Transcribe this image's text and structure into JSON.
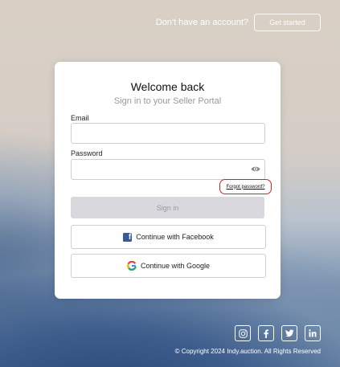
{
  "header": {
    "prompt": "Don't have an account?",
    "get_started_label": "Get started"
  },
  "card": {
    "title": "Welcome back",
    "subtitle": "Sign in to your Seller Portal",
    "email_label": "Email",
    "email_value": "",
    "password_label": "Password",
    "password_value": "",
    "forgot_label": "Forgot password?",
    "sign_in_label": "Sign in",
    "facebook_label": "Continue with Facebook",
    "google_label": "Continue with Google"
  },
  "footer": {
    "social_icons": [
      "instagram-icon",
      "facebook-icon",
      "twitter-icon",
      "linkedin-icon"
    ],
    "copyright": "© Copyright 2024 Indy.auction. All Rights Reserved"
  },
  "colors": {
    "highlight": "#e21d1d",
    "facebook": "#3b5998",
    "sign_in_disabled": "#d9d8dd"
  }
}
